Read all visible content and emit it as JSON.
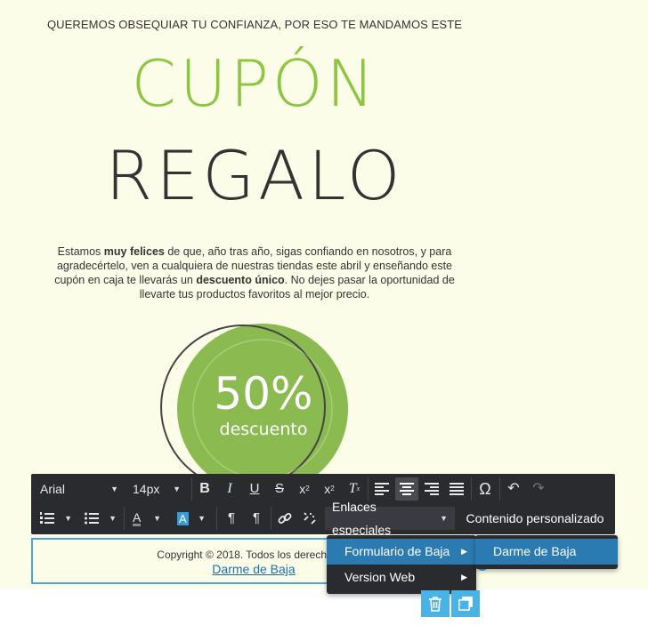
{
  "email": {
    "intro": "QUEREMOS OBSEQUIAR TU CONFIANZA, POR ESO TE MANDAMOS ESTE",
    "headline_1": "CUPÓN",
    "headline_2": "REGALO",
    "body": {
      "t1": "Estamos ",
      "b1": "muy felices",
      "t2": " de que, año tras año, sigas confiando en nosotros, y para agradecértelo, ven a cualquiera de nuestras tiendas este abril y enseñando este cupón en caja te llevarás un ",
      "b2": "descuento único",
      "t3": ". No dejes pasar la oportunidad de llevarte tus productos favoritos al mejor precio."
    },
    "badge": {
      "percent": "50%",
      "label": "descuento"
    },
    "footer": {
      "copyright": "Copyright © 2018. Todos los derechos re",
      "unsubscribe_link": "Darme de Baja"
    }
  },
  "toolbar": {
    "font_family": "Arial",
    "font_size": "14px",
    "special_links": "Enlaces especiales",
    "custom_content": "Contenido personalizado"
  },
  "menus": {
    "special_links_items": [
      "Formulario de Baja",
      "Version Web"
    ],
    "unsubscribe_items": [
      "Darme de Baja"
    ]
  },
  "colors": {
    "brand_green": "#8cc63f",
    "dark_text": "#333333",
    "toolbar_bg": "#2a2b2f",
    "highlight": "#2b7bb2",
    "selection_border": "#4aa5d8",
    "action_blue": "#4ab3e6"
  }
}
